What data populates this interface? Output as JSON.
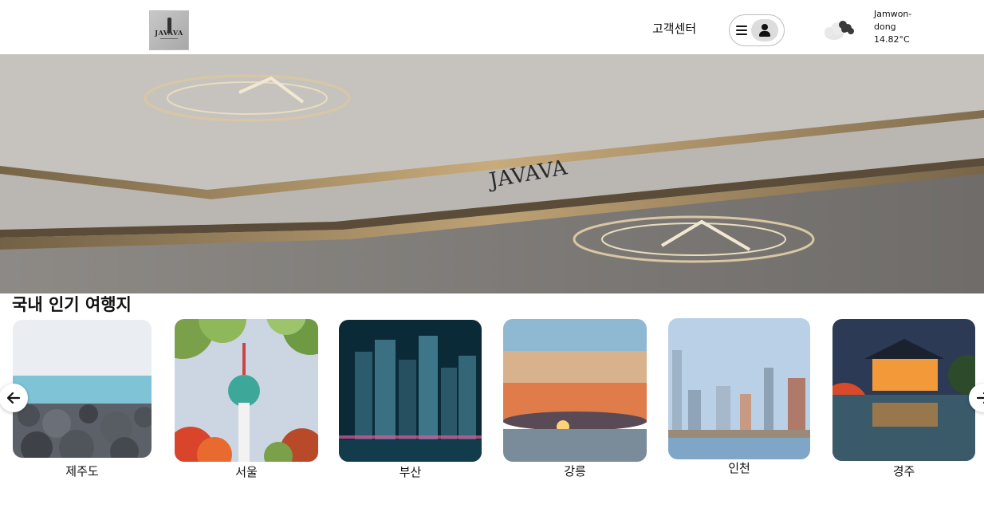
{
  "header": {
    "logo_text": "JAVAVA",
    "customer_center_label": "고객센터",
    "weather": {
      "location_line1": "Jamwon-",
      "location_line2": "dong",
      "temperature": "14.82°C",
      "icon": "cloud-icon"
    },
    "menu_icons": [
      "hamburger-icon",
      "user-icon"
    ]
  },
  "hero": {
    "alt_brand_text": "JAVAVA"
  },
  "section": {
    "title": "국내 인기 여행지"
  },
  "destinations": [
    {
      "name": "제주도",
      "scene": "rocky-coast"
    },
    {
      "name": "서울",
      "scene": "namsan-tower"
    },
    {
      "name": "부산",
      "scene": "night-skyline"
    },
    {
      "name": "강릉",
      "scene": "sunrise-sea"
    },
    {
      "name": "인천",
      "scene": "city-skyline"
    },
    {
      "name": "경주",
      "scene": "palace-reflection"
    }
  ],
  "carousel": {
    "prev_icon": "arrow-left-icon",
    "next_icon": "arrow-right-icon"
  },
  "colors": {
    "text": "#111111",
    "border": "#bdbdbd",
    "avatar_bg": "#dcdcdc"
  }
}
